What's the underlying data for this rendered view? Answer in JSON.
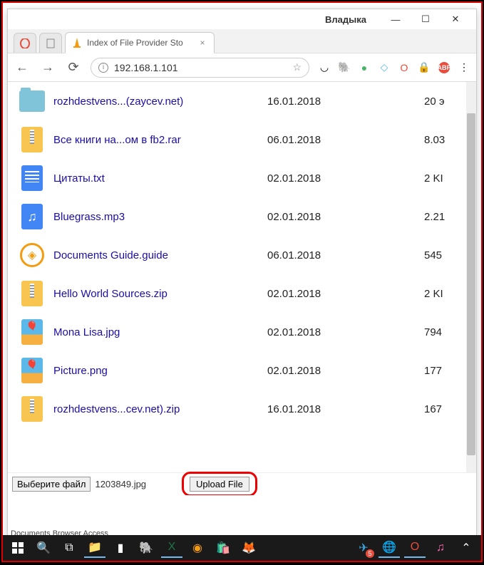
{
  "titlebar": {
    "user": "Владыка"
  },
  "tab": {
    "title": "Index of File Provider Sto"
  },
  "url": "192.168.1.101",
  "files": [
    {
      "icon": "folder",
      "name": "rozhdestvens...(zaycev.net)",
      "date": "16.01.2018",
      "size": "20 э"
    },
    {
      "icon": "zip",
      "name": "Все книги на...ом в fb2.rar",
      "date": "06.01.2018",
      "size": "8.03"
    },
    {
      "icon": "txt",
      "name": "Цитаты.txt",
      "date": "02.01.2018",
      "size": "2 KI"
    },
    {
      "icon": "mp3",
      "name": "Bluegrass.mp3",
      "date": "02.01.2018",
      "size": "2.21"
    },
    {
      "icon": "guide",
      "name": "Documents Guide.guide",
      "date": "06.01.2018",
      "size": "545"
    },
    {
      "icon": "zip",
      "name": "Hello World Sources.zip",
      "date": "02.01.2018",
      "size": "2 KI"
    },
    {
      "icon": "img",
      "name": "Mona Lisa.jpg",
      "date": "02.01.2018",
      "size": "794"
    },
    {
      "icon": "img",
      "name": "Picture.png",
      "date": "02.01.2018",
      "size": "177"
    },
    {
      "icon": "zip",
      "name": "rozhdestvens...cev.net).zip",
      "date": "16.01.2018",
      "size": "167"
    }
  ],
  "upload": {
    "choose_label": "Выберите файл",
    "chosen": "1203849.jpg",
    "upload_label": "Upload File"
  },
  "footer_text": "Documents Browser Access"
}
